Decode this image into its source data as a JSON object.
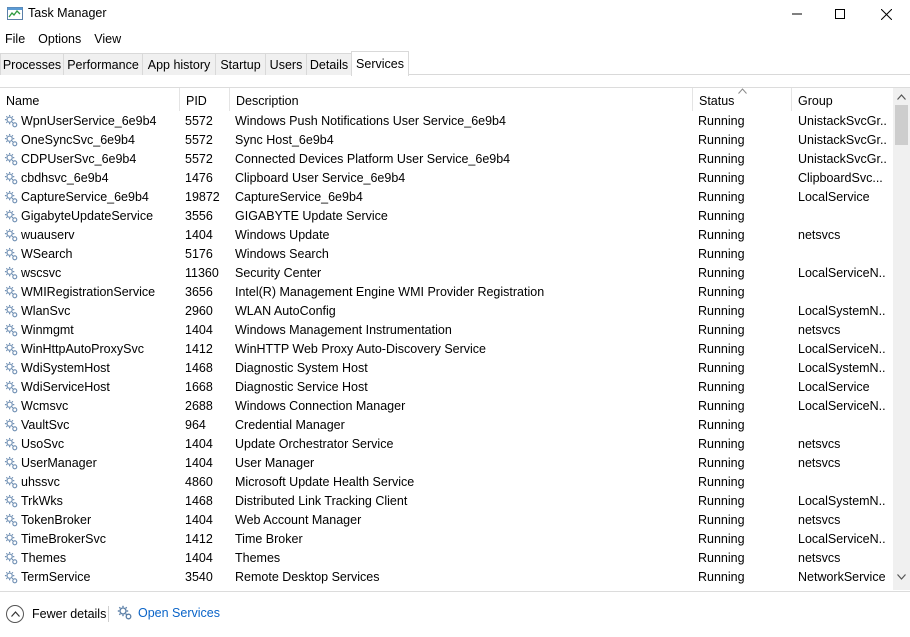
{
  "window": {
    "title": "Task Manager",
    "icon": "task-manager-icon",
    "controls": [
      "minimize-icon",
      "maximize-icon",
      "close-icon"
    ]
  },
  "menu": [
    "File",
    "Options",
    "View"
  ],
  "tabs": [
    {
      "label": "Processes",
      "active": false
    },
    {
      "label": "Performance",
      "active": false
    },
    {
      "label": "App history",
      "active": false
    },
    {
      "label": "Startup",
      "active": false
    },
    {
      "label": "Users",
      "active": false
    },
    {
      "label": "Details",
      "active": false
    },
    {
      "label": "Services",
      "active": true
    }
  ],
  "columns": {
    "name": "Name",
    "pid": "PID",
    "description": "Description",
    "status": "Status",
    "group": "Group",
    "sorted_column": "status"
  },
  "services": [
    {
      "name": "WpnUserService_6e9b4",
      "pid": "5572",
      "description": "Windows Push Notifications User Service_6e9b4",
      "status": "Running",
      "group": "UnistackSvcGr..."
    },
    {
      "name": "OneSyncSvc_6e9b4",
      "pid": "5572",
      "description": "Sync Host_6e9b4",
      "status": "Running",
      "group": "UnistackSvcGr..."
    },
    {
      "name": "CDPUserSvc_6e9b4",
      "pid": "5572",
      "description": "Connected Devices Platform User Service_6e9b4",
      "status": "Running",
      "group": "UnistackSvcGr..."
    },
    {
      "name": "cbdhsvc_6e9b4",
      "pid": "1476",
      "description": "Clipboard User Service_6e9b4",
      "status": "Running",
      "group": "ClipboardSvc..."
    },
    {
      "name": "CaptureService_6e9b4",
      "pid": "19872",
      "description": "CaptureService_6e9b4",
      "status": "Running",
      "group": "LocalService"
    },
    {
      "name": "GigabyteUpdateService",
      "pid": "3556",
      "description": "GIGABYTE Update Service",
      "status": "Running",
      "group": ""
    },
    {
      "name": "wuauserv",
      "pid": "1404",
      "description": "Windows Update",
      "status": "Running",
      "group": "netsvcs"
    },
    {
      "name": "WSearch",
      "pid": "5176",
      "description": "Windows Search",
      "status": "Running",
      "group": ""
    },
    {
      "name": "wscsvc",
      "pid": "11360",
      "description": "Security Center",
      "status": "Running",
      "group": "LocalServiceN..."
    },
    {
      "name": "WMIRegistrationService",
      "pid": "3656",
      "description": "Intel(R) Management Engine WMI Provider Registration",
      "status": "Running",
      "group": ""
    },
    {
      "name": "WlanSvc",
      "pid": "2960",
      "description": "WLAN AutoConfig",
      "status": "Running",
      "group": "LocalSystemN..."
    },
    {
      "name": "Winmgmt",
      "pid": "1404",
      "description": "Windows Management Instrumentation",
      "status": "Running",
      "group": "netsvcs"
    },
    {
      "name": "WinHttpAutoProxySvc",
      "pid": "1412",
      "description": "WinHTTP Web Proxy Auto-Discovery Service",
      "status": "Running",
      "group": "LocalServiceN..."
    },
    {
      "name": "WdiSystemHost",
      "pid": "1468",
      "description": "Diagnostic System Host",
      "status": "Running",
      "group": "LocalSystemN..."
    },
    {
      "name": "WdiServiceHost",
      "pid": "1668",
      "description": "Diagnostic Service Host",
      "status": "Running",
      "group": "LocalService"
    },
    {
      "name": "Wcmsvc",
      "pid": "2688",
      "description": "Windows Connection Manager",
      "status": "Running",
      "group": "LocalServiceN..."
    },
    {
      "name": "VaultSvc",
      "pid": "964",
      "description": "Credential Manager",
      "status": "Running",
      "group": ""
    },
    {
      "name": "UsoSvc",
      "pid": "1404",
      "description": "Update Orchestrator Service",
      "status": "Running",
      "group": "netsvcs"
    },
    {
      "name": "UserManager",
      "pid": "1404",
      "description": "User Manager",
      "status": "Running",
      "group": "netsvcs"
    },
    {
      "name": "uhssvc",
      "pid": "4860",
      "description": "Microsoft Update Health Service",
      "status": "Running",
      "group": ""
    },
    {
      "name": "TrkWks",
      "pid": "1468",
      "description": "Distributed Link Tracking Client",
      "status": "Running",
      "group": "LocalSystemN..."
    },
    {
      "name": "TokenBroker",
      "pid": "1404",
      "description": "Web Account Manager",
      "status": "Running",
      "group": "netsvcs"
    },
    {
      "name": "TimeBrokerSvc",
      "pid": "1412",
      "description": "Time Broker",
      "status": "Running",
      "group": "LocalServiceN..."
    },
    {
      "name": "Themes",
      "pid": "1404",
      "description": "Themes",
      "status": "Running",
      "group": "netsvcs"
    },
    {
      "name": "TermService",
      "pid": "3540",
      "description": "Remote Desktop Services",
      "status": "Running",
      "group": "NetworkService"
    }
  ],
  "footer": {
    "fewer_details": "Fewer details",
    "open_services": "Open Services"
  },
  "colors": {
    "link": "#0a64c8",
    "border": "#d9d9d9",
    "tab_inactive_bg": "#f0f0f0"
  }
}
